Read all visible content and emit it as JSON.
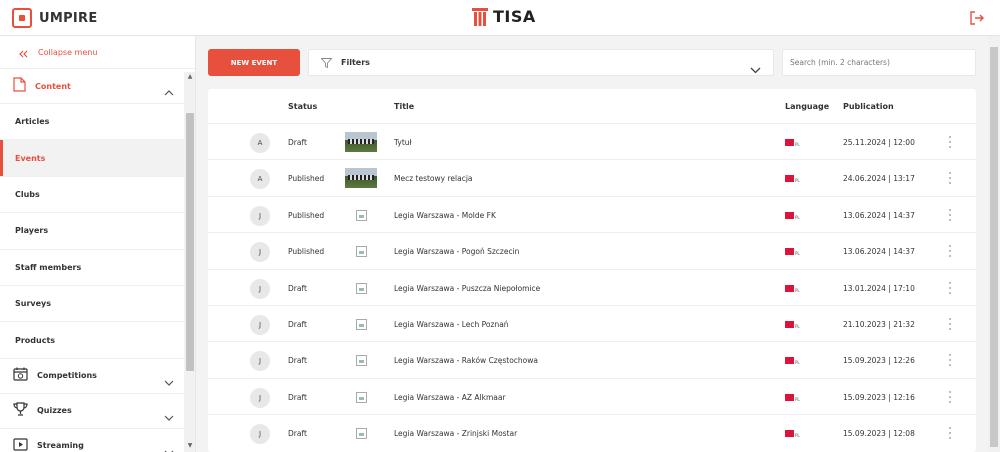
{
  "app": {
    "brand": "UMPIRE",
    "center_brand": "TISA"
  },
  "colors": {
    "accent": "#e8503e"
  },
  "sidebar": {
    "collapse_label": "Collapse menu",
    "content_group": {
      "label": "Content",
      "icon": "document-icon",
      "expanded": true
    },
    "items": [
      {
        "label": "Articles",
        "active": false
      },
      {
        "label": "Events",
        "active": true
      },
      {
        "label": "Clubs",
        "active": false
      },
      {
        "label": "Players",
        "active": false
      },
      {
        "label": "Staff members",
        "active": false
      },
      {
        "label": "Surveys",
        "active": false
      },
      {
        "label": "Products",
        "active": false
      }
    ],
    "groups": [
      {
        "label": "Competitions",
        "icon": "calendar-icon"
      },
      {
        "label": "Quizzes",
        "icon": "trophy-icon"
      },
      {
        "label": "Streaming",
        "icon": "play-icon"
      }
    ]
  },
  "toolbar": {
    "new_event_label": "NEW EVENT",
    "filters_label": "Filters",
    "search_placeholder": "Search (min. 2 characters)"
  },
  "table": {
    "columns": {
      "status": "Status",
      "title": "Title",
      "language": "Language",
      "publication": "Publication"
    },
    "rows": [
      {
        "avatar": "A",
        "status": "Draft",
        "image": "photo",
        "title": "Tytuł",
        "lang": "PL",
        "publication": "25.11.2024 | 12:00"
      },
      {
        "avatar": "A",
        "status": "Published",
        "image": "photo",
        "title": "Mecz testowy relacja",
        "lang": "PL",
        "publication": "24.06.2024 | 13:17"
      },
      {
        "avatar": "J",
        "status": "Published",
        "image": "broken",
        "title": "Legia Warszawa - Molde FK",
        "lang": "PL",
        "publication": "13.06.2024 | 14:37"
      },
      {
        "avatar": "J",
        "status": "Published",
        "image": "broken",
        "title": "Legia Warszawa - Pogoń Szczecin",
        "lang": "PL",
        "publication": "13.06.2024 | 14:37"
      },
      {
        "avatar": "J",
        "status": "Draft",
        "image": "broken",
        "title": "Legia Warszawa - Puszcza Niepołomice",
        "lang": "PL",
        "publication": "13.01.2024 | 17:10"
      },
      {
        "avatar": "J",
        "status": "Draft",
        "image": "broken",
        "title": "Legia Warszawa - Lech Poznań",
        "lang": "PL",
        "publication": "21.10.2023 | 21:32"
      },
      {
        "avatar": "J",
        "status": "Draft",
        "image": "broken",
        "title": "Legia Warszawa - Raków Częstochowa",
        "lang": "PL",
        "publication": "15.09.2023 | 12:26"
      },
      {
        "avatar": "J",
        "status": "Draft",
        "image": "broken",
        "title": "Legia Warszawa - AZ Alkmaar",
        "lang": "PL",
        "publication": "15.09.2023 | 12:16"
      },
      {
        "avatar": "J",
        "status": "Draft",
        "image": "broken",
        "title": "Legia Warszawa - Zrinjski Mostar",
        "lang": "PL",
        "publication": "15.09.2023 | 12:08"
      }
    ]
  }
}
